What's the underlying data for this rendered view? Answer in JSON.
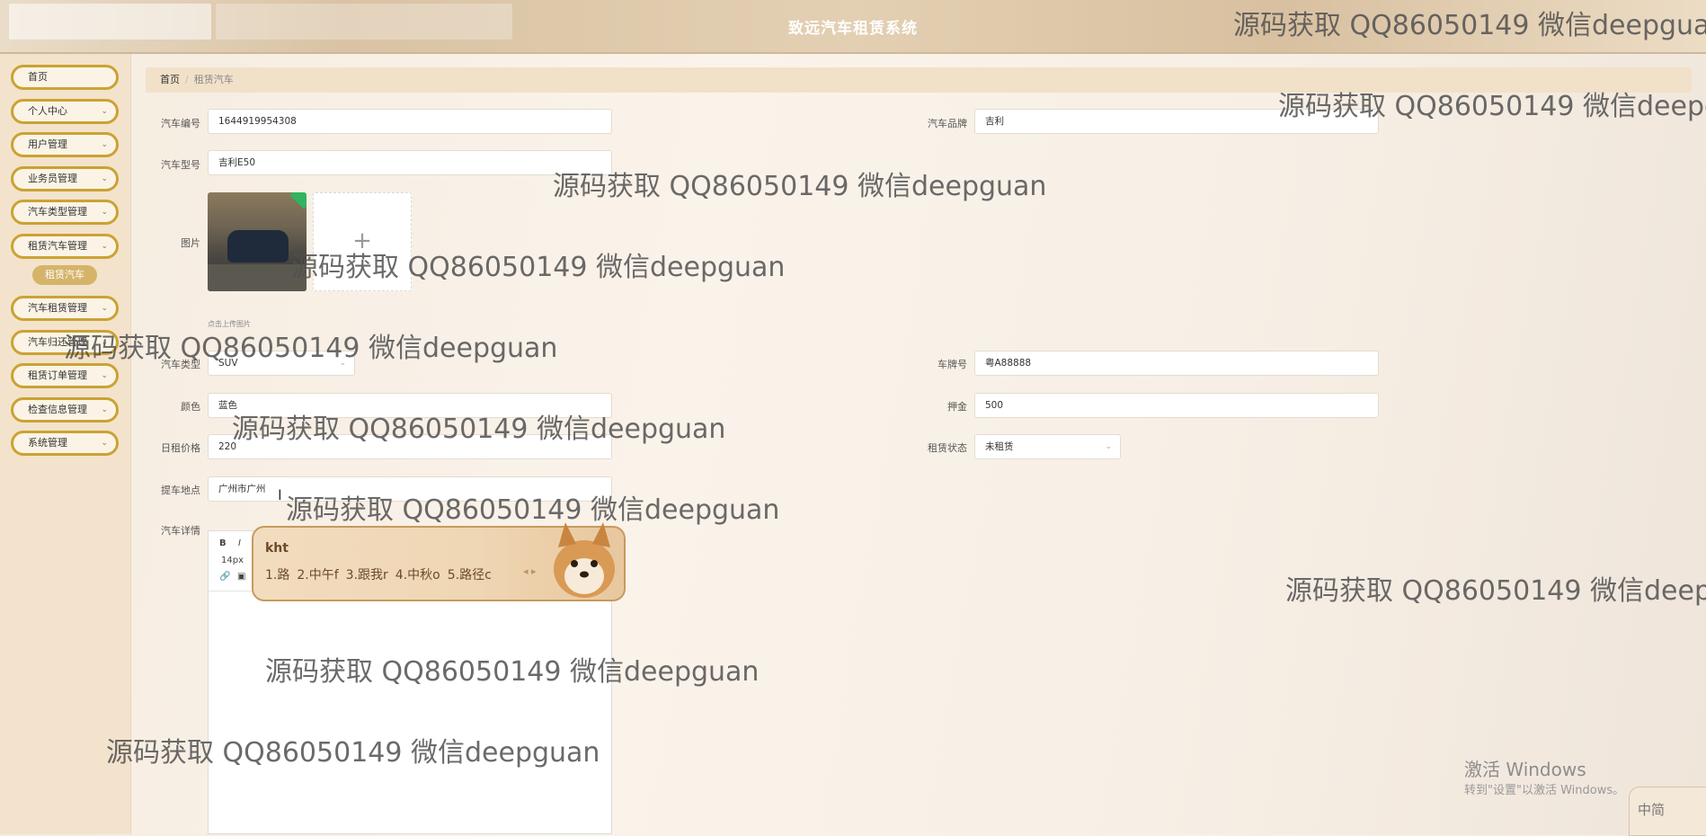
{
  "header": {
    "title": "致远汽车租赁系统"
  },
  "sidebar": {
    "items": [
      {
        "label": "首页",
        "has_children": false
      },
      {
        "label": "个人中心",
        "has_children": true
      },
      {
        "label": "用户管理",
        "has_children": true
      },
      {
        "label": "业务员管理",
        "has_children": true
      },
      {
        "label": "汽车类型管理",
        "has_children": true
      },
      {
        "label": "租赁汽车管理",
        "has_children": true
      },
      {
        "label": "汽车租赁管理",
        "has_children": true
      },
      {
        "label": "汽车归还管理",
        "has_children": true
      },
      {
        "label": "租赁订单管理",
        "has_children": true
      },
      {
        "label": "检查信息管理",
        "has_children": true
      },
      {
        "label": "系统管理",
        "has_children": true
      }
    ],
    "active_subitem": "租赁汽车"
  },
  "breadcrumb": {
    "home": "首页",
    "current": "租赁汽车"
  },
  "form": {
    "car_no": {
      "label": "汽车编号",
      "value": "1644919954308"
    },
    "brand": {
      "label": "汽车品牌",
      "value": "吉利"
    },
    "model": {
      "label": "汽车型号",
      "value": "吉利E50"
    },
    "image": {
      "label": "图片",
      "upload_hint": "点击上传图片",
      "plus": "+"
    },
    "type": {
      "label": "汽车类型",
      "value": "SUV"
    },
    "plate": {
      "label": "车牌号",
      "value": "粤A88888"
    },
    "color": {
      "label": "颜色",
      "value": "蓝色"
    },
    "deposit": {
      "label": "押金",
      "value": "500"
    },
    "daily_price": {
      "label": "日租价格",
      "value": "220"
    },
    "rent_status": {
      "label": "租赁状态",
      "value": "未租赁"
    },
    "pickup": {
      "label": "提车地点",
      "value": "广州市广州"
    },
    "details": {
      "label": "汽车详情",
      "toolbar": {
        "bold": "B",
        "italic": "I",
        "font_size": "14px"
      }
    }
  },
  "ime": {
    "input": "kht",
    "candidates": [
      "1.路",
      "2.中午f",
      "3.跟我r",
      "4.中秋o",
      "5.路径c"
    ]
  },
  "watermark_text": "源码获取 QQ86050149 微信deepguan",
  "watermark_partial": [
    "源码获取 QQ86050149 微信deepguar",
    "源码获取 QQ86050149 微信deepg"
  ],
  "windows": {
    "activate_title": "激活 Windows",
    "activate_sub": "转到\"设置\"以激活 Windows。",
    "ime_mode": "中简"
  },
  "colors": {
    "menu_border": "#cba233",
    "submenu_active": "#d5b46a",
    "check": "#31b460"
  }
}
